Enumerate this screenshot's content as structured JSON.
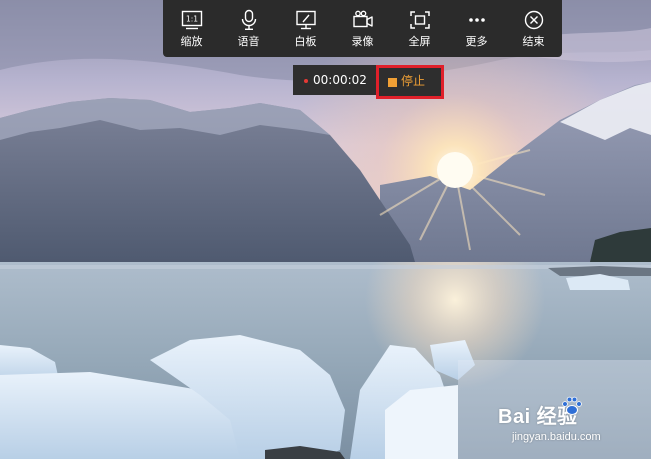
{
  "toolbar": {
    "items": [
      {
        "label": "缩放",
        "icon": "zoom-icon"
      },
      {
        "label": "语音",
        "icon": "microphone-icon"
      },
      {
        "label": "白板",
        "icon": "whiteboard-icon"
      },
      {
        "label": "录像",
        "icon": "video-camera-icon"
      },
      {
        "label": "全屏",
        "icon": "fullscreen-icon"
      },
      {
        "label": "更多",
        "icon": "more-icon"
      },
      {
        "label": "结束",
        "icon": "close-icon"
      }
    ],
    "zoom_icon_text": "1:1"
  },
  "recording": {
    "timer": "00:00:02",
    "stop_label": "停止",
    "dot_color": "#e53935",
    "stop_color": "#f0a035",
    "highlight_color": "#e0202a"
  },
  "watermark": {
    "logo_text": "Bai  经验",
    "url": "jingyan.baidu.com"
  }
}
